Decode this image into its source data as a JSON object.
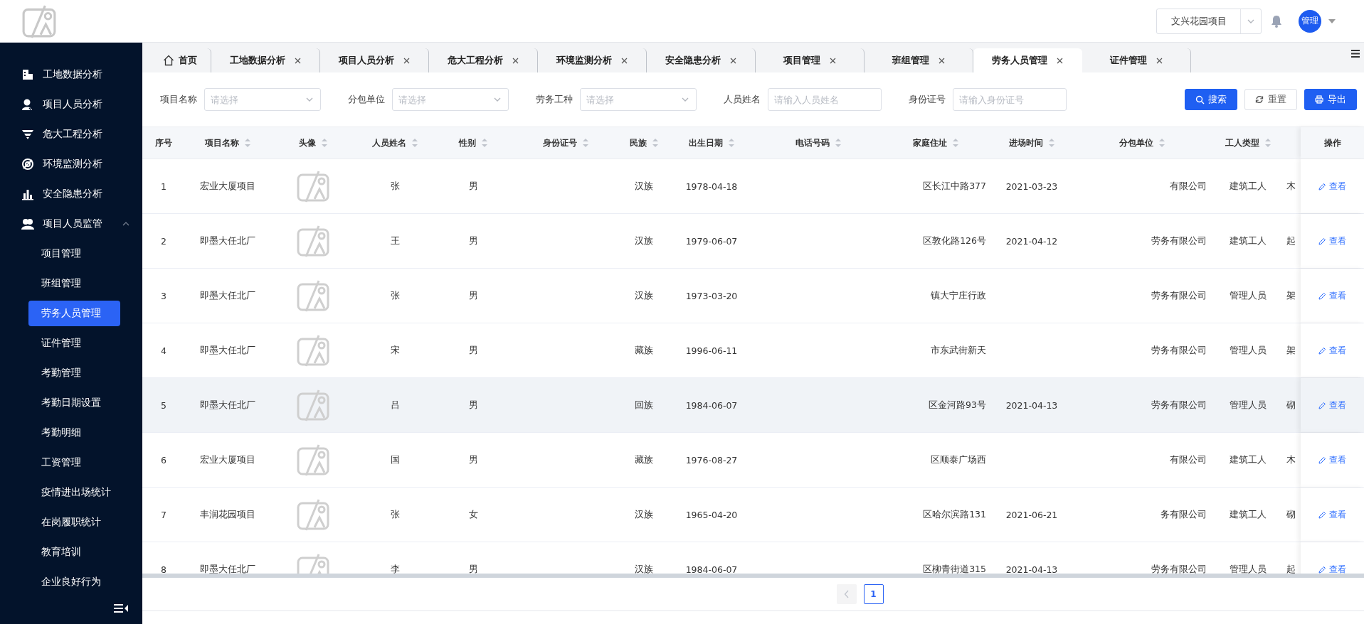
{
  "header": {
    "project_select": {
      "value": "文兴花园项目"
    },
    "user_avatar": "管理"
  },
  "sidebar": {
    "items": [
      {
        "label": "工地数据分析"
      },
      {
        "label": "项目人员分析"
      },
      {
        "label": "危大工程分析"
      },
      {
        "label": "环境监测分析"
      },
      {
        "label": "安全隐患分析"
      },
      {
        "label": "项目人员监管",
        "expanded": true,
        "children": [
          {
            "label": "项目管理",
            "selected": false
          },
          {
            "label": "班组管理",
            "selected": false
          },
          {
            "label": "劳务人员管理",
            "selected": true
          },
          {
            "label": "证件管理",
            "selected": false
          },
          {
            "label": "考勤管理",
            "selected": false
          },
          {
            "label": "考勤日期设置",
            "selected": false
          },
          {
            "label": "考勤明细",
            "selected": false
          },
          {
            "label": "工资管理",
            "selected": false
          },
          {
            "label": "疫情进出场统计",
            "selected": false
          },
          {
            "label": "在岗履职统计",
            "selected": false
          },
          {
            "label": "教育培训",
            "selected": false
          },
          {
            "label": "企业良好行为",
            "selected": false
          }
        ]
      }
    ]
  },
  "tabs": [
    {
      "label": "首页",
      "selected": false,
      "closable": false
    },
    {
      "label": "工地数据分析",
      "selected": false,
      "closable": true
    },
    {
      "label": "项目人员分析",
      "selected": false,
      "closable": true
    },
    {
      "label": "危大工程分析",
      "selected": false,
      "closable": true
    },
    {
      "label": "环境监测分析",
      "selected": false,
      "closable": true
    },
    {
      "label": "安全隐患分析",
      "selected": false,
      "closable": true
    },
    {
      "label": "项目管理",
      "selected": false,
      "closable": true
    },
    {
      "label": "班组管理",
      "selected": false,
      "closable": true
    },
    {
      "label": "劳务人员管理",
      "selected": true,
      "closable": true
    },
    {
      "label": "证件管理",
      "selected": false,
      "closable": true
    }
  ],
  "filters": [
    {
      "label": "项目名称",
      "kind": "select",
      "placeholder": "请选择"
    },
    {
      "label": "分包单位",
      "kind": "select",
      "placeholder": "请选择"
    },
    {
      "label": "劳务工种",
      "kind": "select",
      "placeholder": "请选择"
    },
    {
      "label": "人员姓名",
      "kind": "input",
      "placeholder": "请输入人员姓名"
    },
    {
      "label": "身份证号",
      "kind": "input",
      "placeholder": "请输入身份证号"
    }
  ],
  "buttons": [
    {
      "label": "搜索",
      "kind": "primary"
    },
    {
      "label": "重置",
      "kind": "default"
    },
    {
      "label": "导出",
      "kind": "primary"
    }
  ],
  "table": {
    "columns": [
      {
        "label": "序号",
        "sortable": false
      },
      {
        "label": "项目名称",
        "sortable": true
      },
      {
        "label": "头像",
        "sortable": true
      },
      {
        "label": "人员姓名",
        "sortable": true
      },
      {
        "label": "性别",
        "sortable": true
      },
      {
        "label": "身份证号",
        "sortable": true
      },
      {
        "label": "民族",
        "sortable": true
      },
      {
        "label": "出生日期",
        "sortable": true
      },
      {
        "label": "电话号码",
        "sortable": true
      },
      {
        "label": "家庭住址",
        "sortable": true
      },
      {
        "label": "进场时间",
        "sortable": true
      },
      {
        "label": "分包单位",
        "sortable": true
      },
      {
        "label": "工人类型",
        "sortable": true
      },
      {
        "label": "操作",
        "sortable": false
      }
    ],
    "rows": [
      {
        "hovered": false,
        "no": "1",
        "project": "宏业大厦项目",
        "name": "张",
        "gender": "男",
        "ethnicity": "汉族",
        "birth_date": "1978-04-18",
        "address": "区长江中路377",
        "entry_date": "2021-03-23",
        "subcontractor": "有限公司",
        "worker_type": "建筑工人",
        "column_14": "木",
        "action": "查看"
      },
      {
        "hovered": false,
        "no": "2",
        "project": "即墨大任北厂",
        "name": "王",
        "gender": "男",
        "ethnicity": "汉族",
        "birth_date": "1979-06-07",
        "address": "区敦化路126号",
        "entry_date": "2021-04-12",
        "subcontractor": "劳务有限公司",
        "worker_type": "建筑工人",
        "column_14": "起",
        "action": "查看"
      },
      {
        "hovered": false,
        "no": "3",
        "project": "即墨大任北厂",
        "name": "张",
        "gender": "男",
        "ethnicity": "汉族",
        "birth_date": "1973-03-20",
        "address": "镇大宁庄行政",
        "subcontractor": "劳务有限公司",
        "worker_type": "管理人员",
        "column_14": "架",
        "action": "查看"
      },
      {
        "hovered": false,
        "no": "4",
        "project": "即墨大任北厂",
        "name": "宋",
        "gender": "男",
        "ethnicity": "藏族",
        "birth_date": "1996-06-11",
        "address": "市东武街新天",
        "subcontractor": "劳务有限公司",
        "worker_type": "管理人员",
        "column_14": "架",
        "action": "查看"
      },
      {
        "hovered": true,
        "no": "5",
        "project": "即墨大任北厂",
        "name": "吕",
        "gender": "男",
        "ethnicity": "回族",
        "birth_date": "1984-06-07",
        "address": "区金河路93号",
        "entry_date": "2021-04-13",
        "subcontractor": "劳务有限公司",
        "worker_type": "管理人员",
        "column_14": "砌",
        "action": "查看"
      },
      {
        "hovered": false,
        "no": "6",
        "project": "宏业大厦项目",
        "name": "国",
        "gender": "男",
        "ethnicity": "藏族",
        "birth_date": "1976-08-27",
        "address": "区顺泰广场西",
        "subcontractor": "有限公司",
        "worker_type": "建筑工人",
        "column_14": "木",
        "action": "查看"
      },
      {
        "hovered": false,
        "no": "7",
        "project": "丰润花园项目",
        "name": "张",
        "gender": "女",
        "ethnicity": "汉族",
        "birth_date": "1965-04-20",
        "address": "区哈尔滨路131",
        "entry_date": "2021-06-21",
        "subcontractor": "务有限公司",
        "worker_type": "建筑工人",
        "column_14": "砌",
        "action": "查看"
      },
      {
        "hovered": false,
        "no": "8",
        "project": "即墨大任北厂",
        "name": "李",
        "gender": "男",
        "ethnicity": "汉族",
        "birth_date": "1984-06-07",
        "address": "区柳青街道315",
        "entry_date": "2021-04-13",
        "subcontractor": "劳务有限公司",
        "worker_type": "管理人员",
        "column_14": "起",
        "action": "查看"
      }
    ]
  },
  "pagination": {
    "prev_disabled": true,
    "pages": [
      {
        "label": "1",
        "selected": true
      }
    ]
  }
}
